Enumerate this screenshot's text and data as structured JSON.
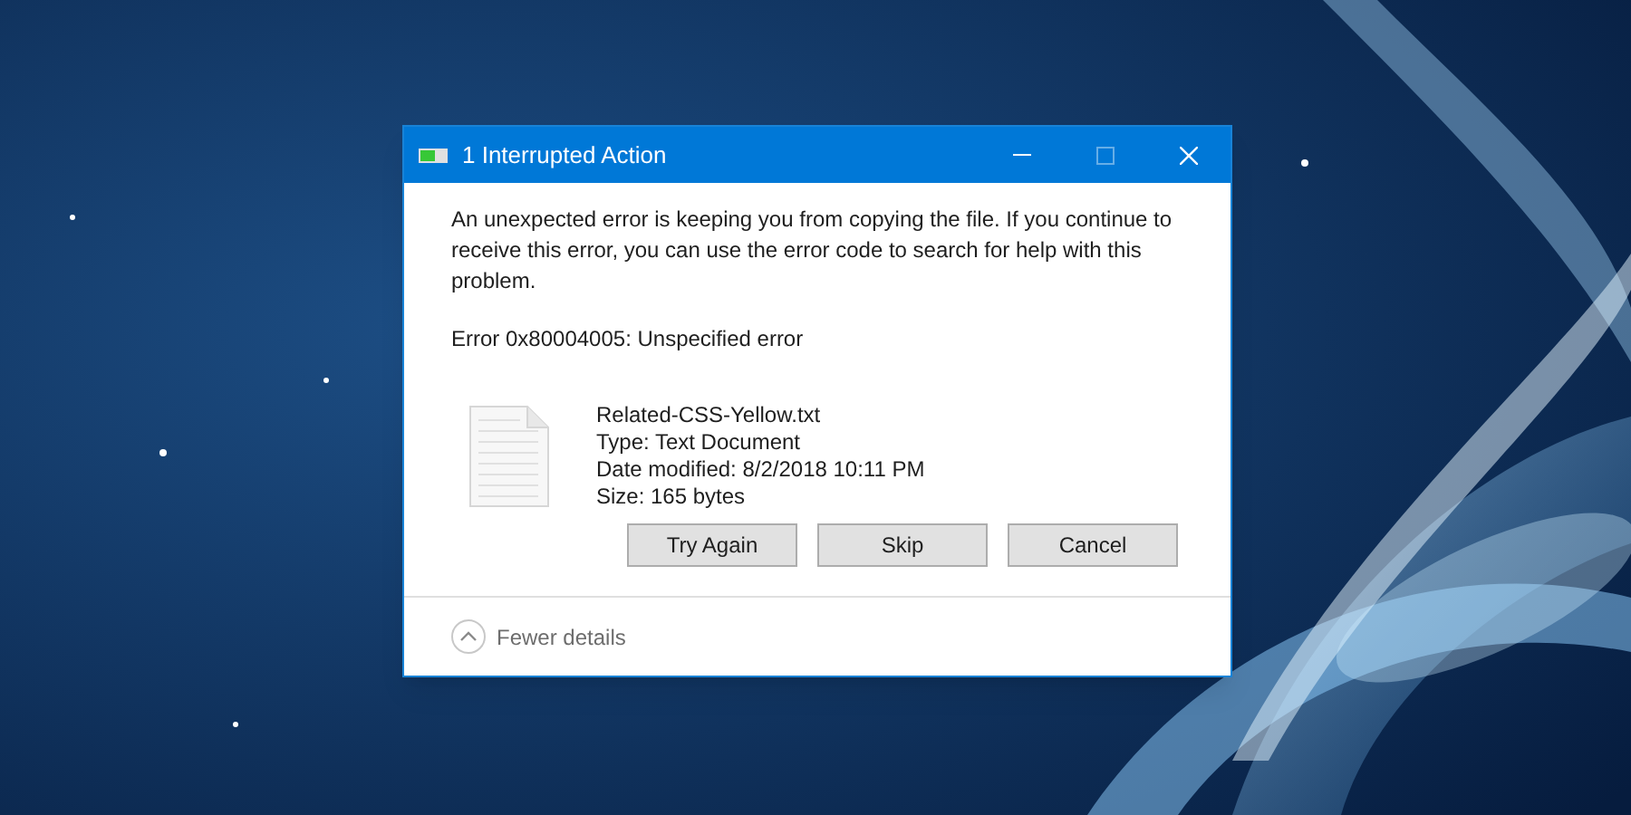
{
  "dialog": {
    "title": "1 Interrupted Action",
    "message": "An unexpected error is keeping you from copying the file. If you continue to receive this error, you can use the error code to search for help with this problem.",
    "error": "Error 0x80004005: Unspecified error",
    "file": {
      "name": "Related-CSS-Yellow.txt",
      "type": "Type: Text Document",
      "modified": "Date modified: 8/2/2018 10:11 PM",
      "size": "Size: 165 bytes"
    },
    "buttons": [
      "Try Again",
      "Skip",
      "Cancel"
    ],
    "details": {
      "label": "Fewer details",
      "expanded": true
    }
  }
}
